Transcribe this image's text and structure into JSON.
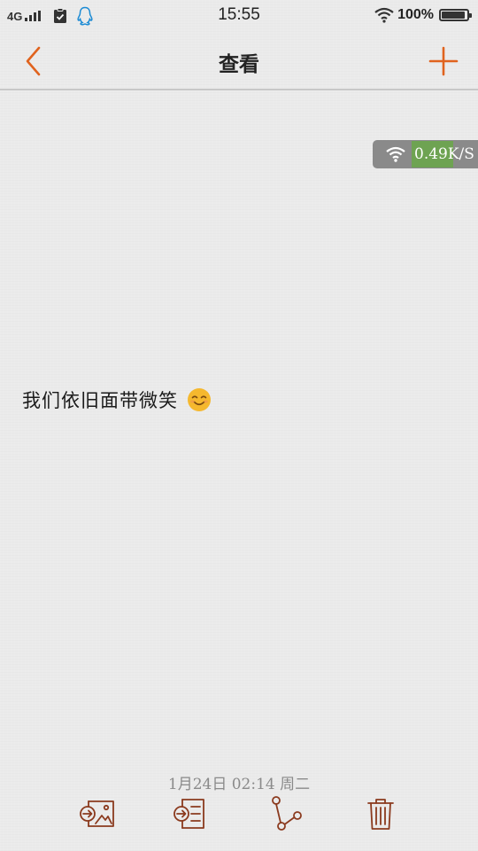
{
  "status_bar": {
    "network": "4G",
    "time": "15:55",
    "battery_percent": "100%",
    "signal_level": 1.0,
    "battery_level": 1.0,
    "icons": [
      "signal-icon",
      "clipboard-check-icon",
      "qq-icon",
      "wifi-icon",
      "battery-icon"
    ]
  },
  "header": {
    "title": "查看",
    "back_icon": "chevron-left-icon",
    "add_icon": "plus-icon"
  },
  "speed_overlay": {
    "speed": "0.49K/S",
    "icon": "wifi-icon"
  },
  "note": {
    "text": "我们依旧面带微笑",
    "emoji": "smiling-face-icon"
  },
  "footer": {
    "date": "1月24日 02:14 周二",
    "actions": [
      "insert-image-icon",
      "export-icon",
      "share-icon",
      "trash-icon"
    ]
  },
  "colors": {
    "accent": "#e0631e",
    "icon_brown": "#8b3a1e",
    "background": "#ebebeb",
    "speed_bg": "#8a8a8a",
    "speed_highlight": "#6ea352",
    "emoji": "#f5b82e"
  }
}
